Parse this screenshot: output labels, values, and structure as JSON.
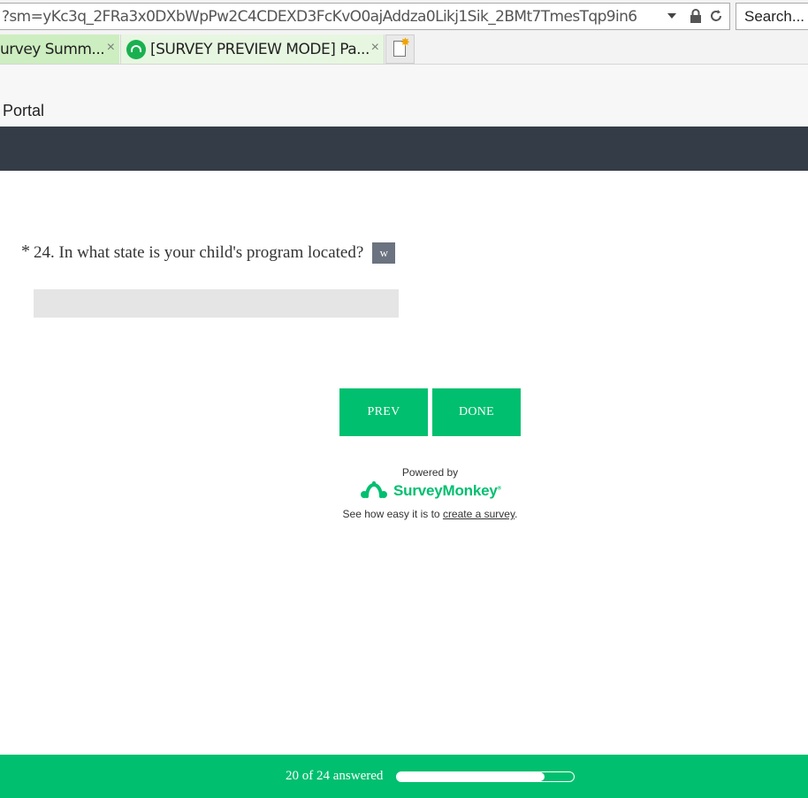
{
  "browser": {
    "url": "?sm=yKc3q_2FRa3x0DXbWpPw2C4CDEXD3FcKvO0ajAddza0Likj1Sik_2BMt7TmesTqp9in6",
    "search_placeholder": "Search...",
    "tabs": [
      {
        "label": "urvey Summ..."
      },
      {
        "label": "[SURVEY PREVIEW MODE] Pa..."
      }
    ],
    "close_glyph": "×",
    "portal_label": "Portal"
  },
  "survey": {
    "required_marker": "*",
    "question_text": "24. In what state is your child's program located?",
    "question_badge": "w",
    "answer_value": "",
    "buttons": {
      "prev": "PREV",
      "done": "DONE"
    },
    "powered_by": "Powered by",
    "brand": "SurveyMonkey",
    "brand_tm": "®",
    "see_how_prefix": "See how easy it is to ",
    "see_how_link": "create a survey",
    "see_how_suffix": "."
  },
  "progress": {
    "label": "20 of 24 answered",
    "answered": 20,
    "total": 24
  },
  "colors": {
    "accent": "#00bf6f",
    "dark_band": "#343d47"
  }
}
